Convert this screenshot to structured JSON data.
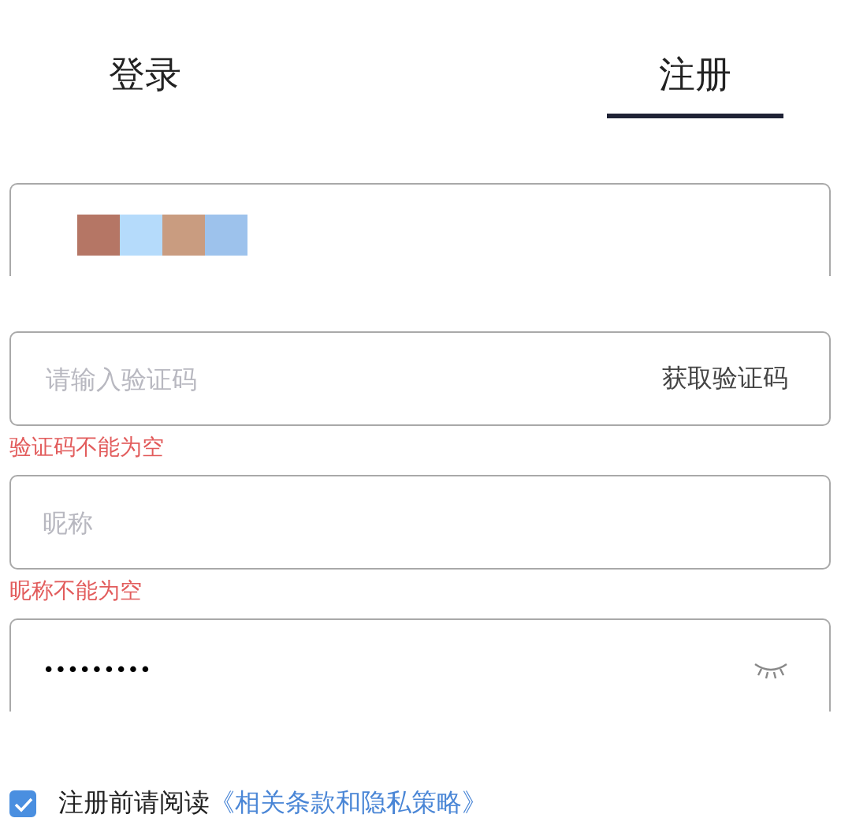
{
  "tabs": [
    {
      "label": "登录",
      "selected": false
    },
    {
      "label": "注册",
      "selected": true
    }
  ],
  "code_field": {
    "placeholder": "请输入验证码",
    "action": "获取验证码",
    "error": "验证码不能为空"
  },
  "nickname_field": {
    "placeholder": "昵称",
    "error": "昵称不能为空"
  },
  "password_field": {
    "value": "•••••••••"
  },
  "agreement": {
    "checked": true,
    "text": "注册前请阅读",
    "link": "《相关条款和隐私策略》"
  }
}
